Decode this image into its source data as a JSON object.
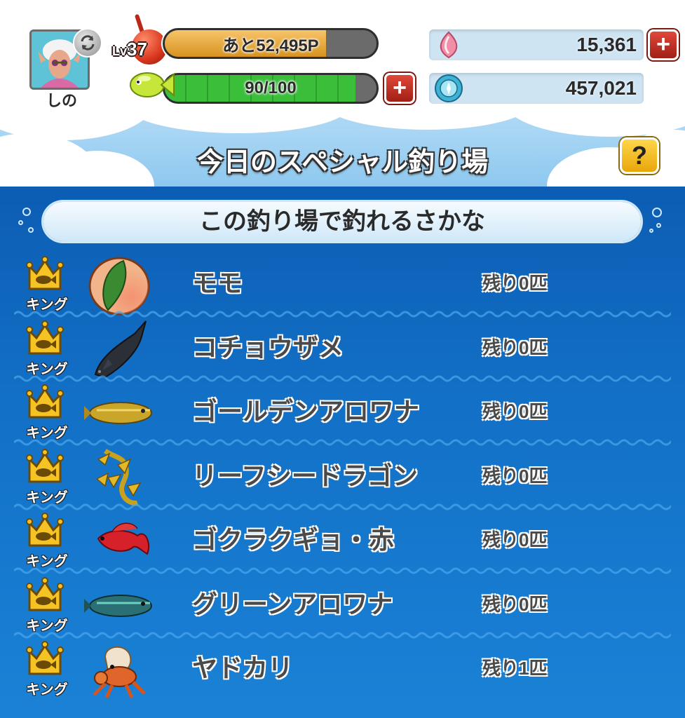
{
  "colors": {
    "water_top": "#0c5db3",
    "water_bottom": "#1a82d6",
    "sky": "#a9d6f4",
    "plus_button": "#c9362a",
    "help_button": "#f2bd25",
    "exp_fill": "#e3a83a",
    "stamina_fill": "#3bbf3b"
  },
  "player": {
    "name": "しの",
    "avatar_icon": "player-avatar-icon",
    "swap_icon": "swap-icon",
    "level_prefix": "Lv",
    "level": "37",
    "exp_text": "あと52,495P",
    "exp_progress": 0.76,
    "stamina_text": "90/100",
    "stamina_progress": 0.9,
    "stamina_plus": "+"
  },
  "currencies": {
    "gems": {
      "icon": "pink-gem-icon",
      "value": "15,361",
      "plus": "+"
    },
    "coins": {
      "icon": "blue-coin-icon",
      "value": "457,021"
    }
  },
  "header": {
    "title": "今日のスペシャル釣り場",
    "help_label": "?"
  },
  "section": {
    "title": "この釣り場で釣れるさかな"
  },
  "fish": [
    {
      "rank": "キング",
      "name": "モモ",
      "remaining": "残り0匹",
      "icon": "peach-icon"
    },
    {
      "rank": "キング",
      "name": "コチョウザメ",
      "remaining": "残り0匹",
      "icon": "paddlefish-icon"
    },
    {
      "rank": "キング",
      "name": "ゴールデンアロワナ",
      "remaining": "残り0匹",
      "icon": "golden-arowana-icon"
    },
    {
      "rank": "キング",
      "name": "リーフシードラゴン",
      "remaining": "残り0匹",
      "icon": "leafy-seadragon-icon"
    },
    {
      "rank": "キング",
      "name": "ゴクラクギョ・赤",
      "remaining": "残り0匹",
      "icon": "red-betta-icon"
    },
    {
      "rank": "キング",
      "name": "グリーンアロワナ",
      "remaining": "残り0匹",
      "icon": "green-arowana-icon"
    },
    {
      "rank": "キング",
      "name": "ヤドカリ",
      "remaining": "残り1匹",
      "icon": "hermit-crab-icon"
    }
  ]
}
